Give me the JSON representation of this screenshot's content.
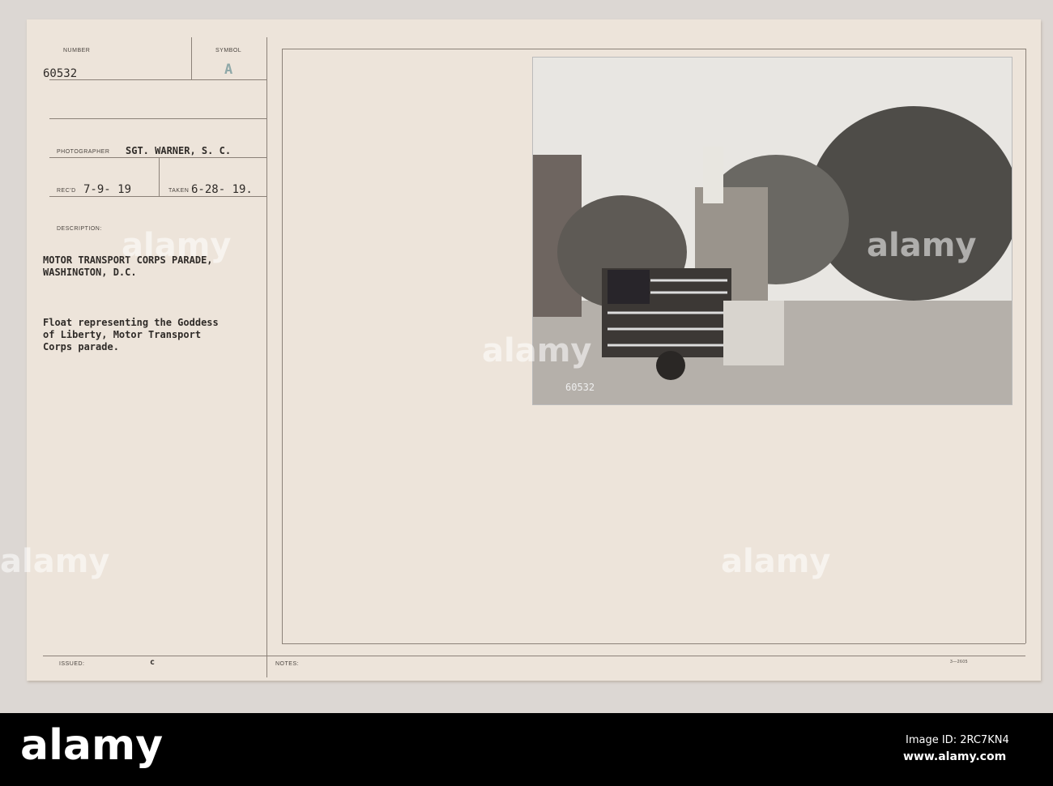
{
  "card": {
    "number_label": "NUMBER",
    "number": "60532",
    "symbol_label": "SYMBOL",
    "symbol": "A",
    "photographer_label": "PHOTOGRAPHER",
    "photographer": "SGT. WARNER, S. C.",
    "recd_label": "REC'D",
    "recd": "7-9- 19",
    "taken_label": "TAKEN",
    "taken": "6-28- 19.",
    "description_label": "DESCRIPTION:",
    "title": "MOTOR TRANSPORT CORPS PARADE,\nWASHINGTON, D.C.",
    "description": "Float representing the Goddess\nof Liberty, Motor Transport\nCorps parade.",
    "issued_label": "ISSUED:",
    "issued": "c",
    "notes_label": "NOTES:",
    "form_code": "3—2605",
    "photo_caption": "60532"
  },
  "watermark": "alamy",
  "footer": {
    "logo": "alamy",
    "image_id": "Image ID: 2RC7KN4",
    "url": "www.alamy.com"
  }
}
